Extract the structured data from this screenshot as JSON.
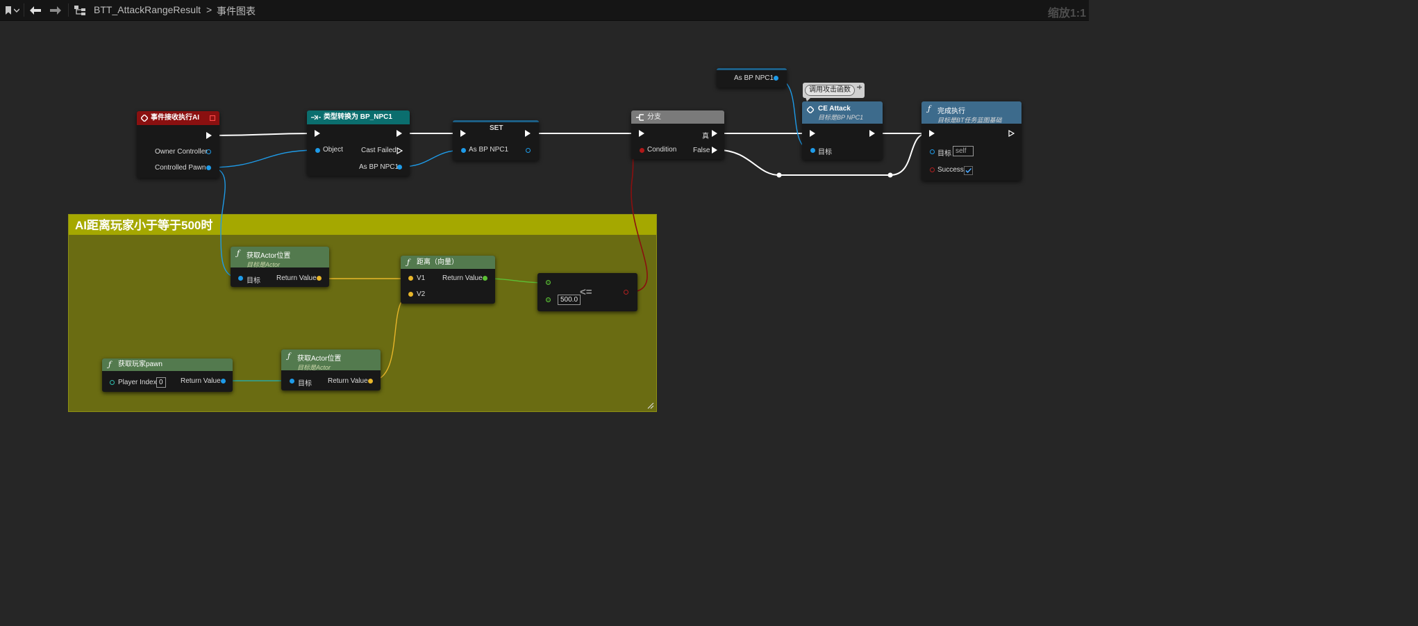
{
  "toolbar": {
    "crumb_asset": "BTT_AttackRangeResult",
    "crumb_sep": ">",
    "crumb_graph": "事件图表",
    "zoom": "缩放1:1"
  },
  "comment": {
    "title": "AI距离玩家小于等于500时"
  },
  "nodes": {
    "event": {
      "title": "事件接收执行AI",
      "owner_controller": "Owner Controller",
      "controlled_pawn": "Controlled Pawn"
    },
    "cast": {
      "title": "类型转换为 BP_NPC1",
      "object": "Object",
      "cast_failed": "Cast Failed",
      "as_bp_npc1": "As BP NPC1"
    },
    "set": {
      "title": "SET",
      "as_bp_npc1": "As BP NPC1"
    },
    "getvar": {
      "label": "As BP NPC1"
    },
    "branch": {
      "title": "分支",
      "condition": "Condition",
      "true_label": "真",
      "false_label": "False"
    },
    "ce_attack": {
      "title": "CE Attack",
      "subtitle": "目标是BP NPC1",
      "target": "目标",
      "comment": "调用攻击函数"
    },
    "finish": {
      "title": "完成执行",
      "subtitle": "目标是BT任务蓝图基础",
      "target": "目标",
      "target_value": "self",
      "success": "Success",
      "success_checked": true
    },
    "getloc1": {
      "title": "获取Actor位置",
      "subtitle": "目标是Actor",
      "target": "目标",
      "return_value": "Return Value"
    },
    "distance": {
      "title": "距离（向量）",
      "v1": "V1",
      "v2": "V2",
      "return_value": "Return Value"
    },
    "compare": {
      "op": "<=",
      "value": "500.0"
    },
    "getpawn": {
      "title": "获取玩家pawn",
      "player_index": "Player Index",
      "player_index_value": "0",
      "return_value": "Return Value"
    },
    "getloc2": {
      "title": "获取Actor位置",
      "subtitle": "目标是Actor",
      "target": "目标",
      "return_value": "Return Value"
    }
  },
  "colors": {
    "event_header": "#8a1010",
    "cast_header": "#0b6e6e",
    "set_header": "#1d5f86",
    "branch_header": "#7a7a7a",
    "function_header": "#3d6b8c",
    "pure_header": "#537a4e",
    "comment_bg": "#6a6c12",
    "comment_header": "#a5a800",
    "wire_object": "#1e9be8",
    "wire_vector": "#e8b62a",
    "wire_float": "#5cc035",
    "wire_bool": "#8a0f0f",
    "wire_exec": "#ffffff"
  },
  "icons": [
    "bookmark-icon",
    "chevron-down-icon",
    "back-arrow-icon",
    "forward-arrow-icon",
    "graph-icon",
    "event-icon",
    "function-icon",
    "branch-icon",
    "cast-icon",
    "delegate-icon",
    "pin-icon"
  ]
}
